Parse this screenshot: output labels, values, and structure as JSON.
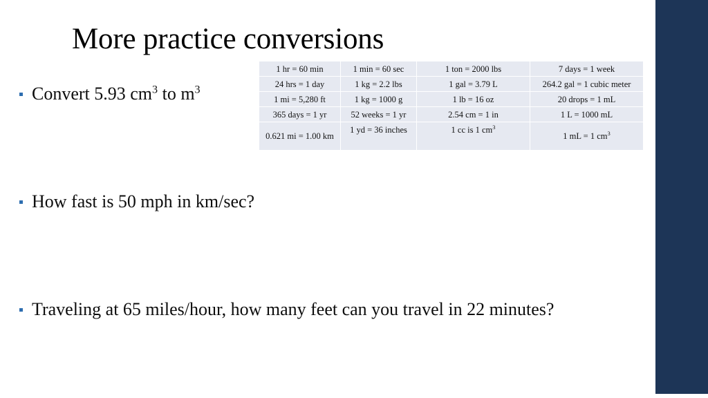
{
  "slide": {
    "title": "More practice conversions",
    "accent_color": "#1d3557",
    "bullet_color": "#2e6eb0",
    "table_cell_color": "#e6e9f1",
    "background_color": "#ffffff"
  },
  "bullets": [
    {
      "text_html": "Convert 5.93 cm<sup>3</sup> to m<sup>3</sup>",
      "text": "Convert 5.93 cm3 to m3"
    },
    {
      "text_html": "How fast is 50 mph in km/sec?",
      "text": "How fast is 50 mph in km/sec?"
    },
    {
      "text_html": "Traveling at 65 miles/hour, how many feet can you travel in 22 minutes?",
      "text": "Traveling at 65 miles/hour, how many feet can you travel in 22 minutes?"
    }
  ],
  "conversion_table": {
    "columns": 4,
    "rows": 5,
    "cells": [
      [
        "1 hr = 60 min",
        "1 min = 60 sec",
        "1 ton = 2000 lbs",
        "7 days = 1 week"
      ],
      [
        "24 hrs = 1 day",
        "1 kg = 2.2 lbs",
        "1 gal = 3.79 L",
        "264.2 gal = 1 cubic meter"
      ],
      [
        "1 mi = 5,280 ft",
        "1 kg = 1000 g",
        "1 lb = 16 oz",
        "20 drops = 1 mL"
      ],
      [
        "365 days = 1 yr",
        "52 weeks = 1 yr",
        "2.54 cm = 1 in",
        "1 L = 1000 mL"
      ],
      [
        "0.621 mi = 1.00 km",
        "1 yd = 36 inches",
        "1 cc is 1 cm<sup>3</sup>",
        "1 mL = 1 cm<sup>3</sup>"
      ]
    ],
    "cells_plain": [
      [
        "1 hr = 60 min",
        "1 min = 60 sec",
        "1 ton = 2000 lbs",
        "7 days = 1 week"
      ],
      [
        "24 hrs = 1 day",
        "1 kg = 2.2 lbs",
        "1 gal = 3.79 L",
        "264.2 gal = 1 cubic meter"
      ],
      [
        "1 mi = 5,280 ft",
        "1 kg = 1000 g",
        "1 lb = 16 oz",
        "20 drops = 1 mL"
      ],
      [
        "365 days = 1 yr",
        "52 weeks = 1 yr",
        "2.54 cm = 1 in",
        "1 L = 1000 mL"
      ],
      [
        "0.621 mi = 1.00 km",
        "1 yd = 36 inches",
        "1 cc is 1 cm3",
        "1 mL = 1 cm3"
      ]
    ]
  }
}
